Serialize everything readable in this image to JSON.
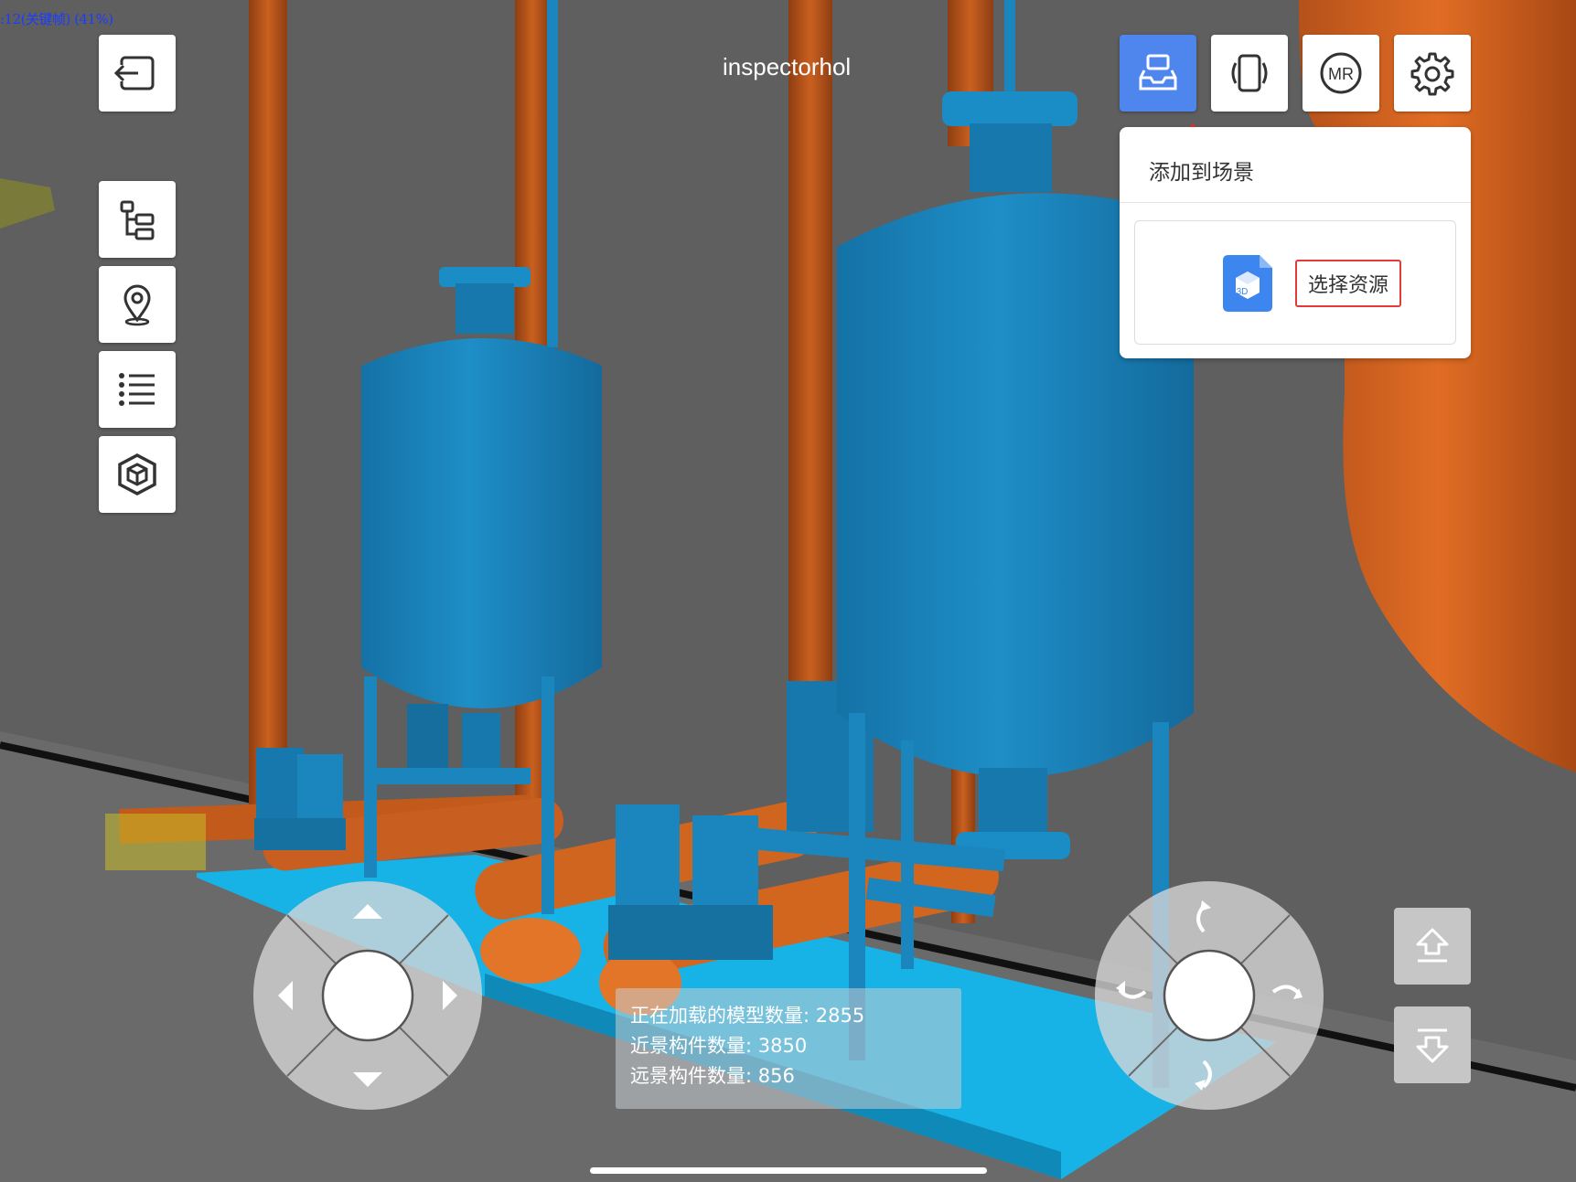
{
  "status": {
    "fps_text": ":12(关键帧) (41%)"
  },
  "scene": {
    "title": "inspectorhol"
  },
  "left_toolbar": [
    {
      "id": "exit",
      "icon": "exit-icon"
    },
    {
      "id": "tree",
      "icon": "tree-structure-icon"
    },
    {
      "id": "location",
      "icon": "location-pin-icon"
    },
    {
      "id": "list",
      "icon": "list-icon"
    },
    {
      "id": "model",
      "icon": "cube-icon"
    }
  ],
  "top_toolbar": [
    {
      "id": "add-to-scene",
      "icon": "inbox-tray-icon",
      "active": true
    },
    {
      "id": "rotate-device",
      "icon": "device-rotate-icon",
      "active": false
    },
    {
      "id": "mr",
      "icon": "mr-icon",
      "label": "MR",
      "active": false
    },
    {
      "id": "settings",
      "icon": "gear-icon",
      "active": false
    }
  ],
  "popup": {
    "title": "添加到场景",
    "select_resource": "选择资源",
    "resource_icon_label": "3D"
  },
  "stats": {
    "loading_models": "正在加载的模型数量: 2855",
    "near_components": "近景构件数量: 3850",
    "far_components": "远景构件数量: 856"
  },
  "colors": {
    "background": "#5f5f5f",
    "equipment_blue": "#1e8bc3",
    "pipe_orange": "#c25a1c",
    "accent_blue": "#4f86ee",
    "highlight_red": "#e33a3a"
  }
}
